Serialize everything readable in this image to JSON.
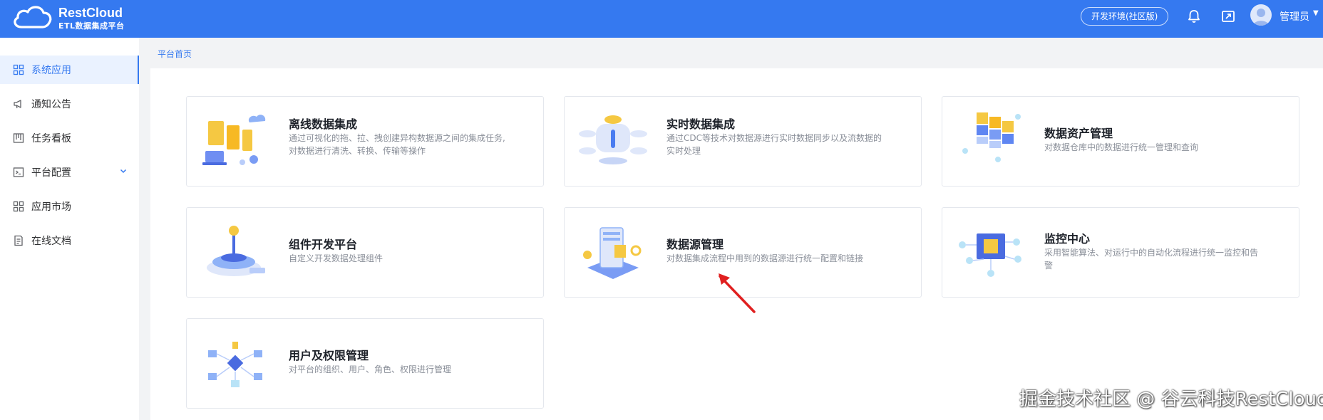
{
  "header": {
    "brand": "RestCloud",
    "brand_sub": "ETL数据集成平台",
    "env_label": "开发环境(社区版)",
    "user_name": "管理员",
    "icons": [
      "bell-icon",
      "exit-icon",
      "avatar"
    ]
  },
  "sidebar": {
    "items": [
      {
        "label": "系统应用",
        "icon": "grid-icon",
        "active": true
      },
      {
        "label": "通知公告",
        "icon": "megaphone-icon",
        "active": false
      },
      {
        "label": "任务看板",
        "icon": "board-icon",
        "active": false
      },
      {
        "label": "平台配置",
        "icon": "terminal-icon",
        "active": false,
        "expandable": true
      },
      {
        "label": "应用市场",
        "icon": "grid-icon",
        "active": false
      },
      {
        "label": "在线文档",
        "icon": "document-icon",
        "active": false
      }
    ]
  },
  "breadcrumb": "平台首页",
  "cards": [
    {
      "title": "离线数据集成",
      "desc": "通过可视化的拖、拉、拽创建异构数据源之间的集成任务,对数据进行清洗、转换、传输等操作"
    },
    {
      "title": "实时数据集成",
      "desc": "通过CDC等技术对数据源进行实时数据同步以及流数据的实时处理"
    },
    {
      "title": "数据资产管理",
      "desc": "对数据仓库中的数据进行统一管理和查询"
    },
    {
      "title": "组件开发平台",
      "desc": "自定义开发数据处理组件"
    },
    {
      "title": "数据源管理",
      "desc": "对数据集成流程中用到的数据源进行统一配置和链接"
    },
    {
      "title": "监控中心",
      "desc": "采用智能算法、对运行中的自动化流程进行统一监控和告警"
    },
    {
      "title": "用户及权限管理",
      "desc": "对平台的组织、用户、角色、权限进行管理"
    }
  ],
  "watermark": "掘金技术社区 @ 谷云科技RestCloud",
  "colors": {
    "primary": "#3579f0",
    "sidebar_active_bg": "#eaf2ff"
  }
}
